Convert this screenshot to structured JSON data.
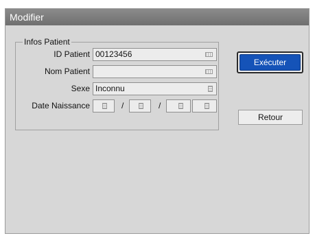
{
  "window": {
    "title": "Modifier"
  },
  "group": {
    "legend": "Infos Patient"
  },
  "fields": {
    "id_label": "ID Patient",
    "id_value": "00123456",
    "name_label": "Nom Patient",
    "name_value": "",
    "sex_label": "Sexe",
    "sex_value": "Inconnu",
    "dob_label": "Date Naissance",
    "dob_sep": "/"
  },
  "buttons": {
    "execute": "Exécuter",
    "back": "Retour"
  },
  "colors": {
    "primary": "#1553b8",
    "titlebar": "#7d7d7d",
    "panel": "#d7d7d7"
  },
  "icons": {
    "keyboard": "keyboard-icon",
    "list": "list-icon"
  }
}
